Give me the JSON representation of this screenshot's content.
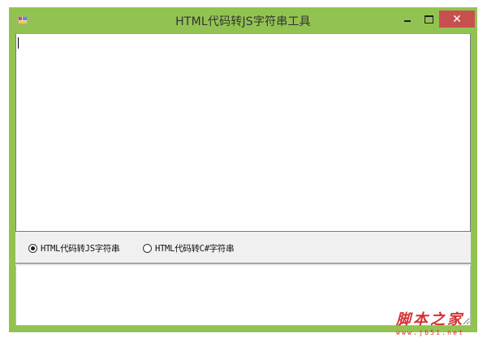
{
  "window": {
    "title": "HTML代码转JS字符串工具",
    "frame_color": "#92c352",
    "close_color": "#c7504f",
    "close_glyph": "✕",
    "controls": {
      "minimize_icon": "minimize-icon",
      "maximize_icon": "maximize-icon",
      "close_icon": "close-icon"
    }
  },
  "input_area": {
    "value": ""
  },
  "options": {
    "selected": "js",
    "items": [
      {
        "id": "js",
        "label": "HTML代码转JS字符串",
        "checked": true
      },
      {
        "id": "csharp",
        "label": "HTML代码转C#字符串",
        "checked": false
      }
    ]
  },
  "output_area": {
    "value": ""
  },
  "watermark": {
    "name": "脚本之家",
    "url": "www.jb51.net"
  }
}
